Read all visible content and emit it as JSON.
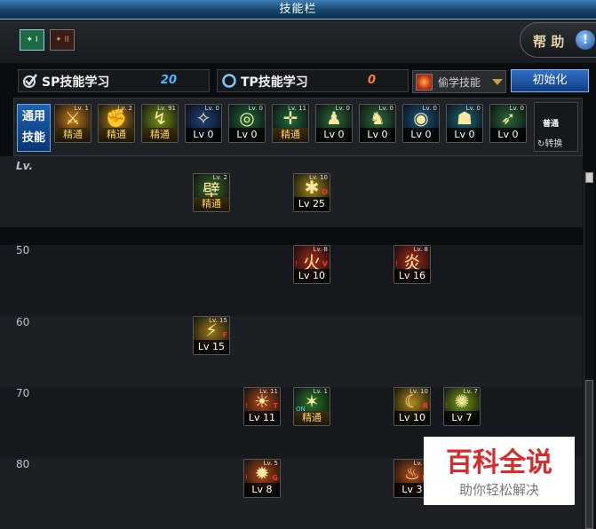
{
  "window": {
    "title": "技能栏"
  },
  "pages": {
    "tab1": "✦ I",
    "tab2": "✦ II"
  },
  "help": {
    "label": "帮 助",
    "icon": "!"
  },
  "sp": {
    "label": "SP技能学习",
    "value": "20"
  },
  "tp": {
    "label": "TP技能学习",
    "value": "0"
  },
  "steal": {
    "label": "偷学技能"
  },
  "init_button": "初始化",
  "common": {
    "label": "通用技能"
  },
  "skill_bar": [
    {
      "icon": "blade-icon",
      "level": "Lv. 1",
      "caption": "精通",
      "master": true,
      "glyph": "⚔",
      "color": "#c77b18"
    },
    {
      "icon": "fist-icon",
      "level": "Lv. 2",
      "caption": "精通",
      "master": true,
      "glyph": "✊",
      "color": "#b5841c"
    },
    {
      "icon": "kick-icon",
      "level": "Lv. 91",
      "caption": "精通",
      "master": true,
      "glyph": "↯",
      "color": "#7a9418"
    },
    {
      "icon": "wing-icon",
      "level": "Lv. 0",
      "caption": "Lv 0",
      "master": false,
      "glyph": "✧",
      "color": "#1f3f7a"
    },
    {
      "icon": "target-icon",
      "level": "Lv. 0",
      "caption": "Lv 0",
      "master": false,
      "glyph": "◎",
      "color": "#1f6a3a"
    },
    {
      "icon": "crosshair-icon",
      "level": "Lv. 11",
      "caption": "精通",
      "master": true,
      "glyph": "✛",
      "color": "#1f6a3a"
    },
    {
      "icon": "figure-icon",
      "level": "Lv. 0",
      "caption": "Lv 0",
      "master": false,
      "glyph": "♟",
      "color": "#2a6c3a"
    },
    {
      "icon": "figure-icon",
      "level": "Lv. 0",
      "caption": "Lv 0",
      "master": false,
      "glyph": "♞",
      "color": "#2a6c3a"
    },
    {
      "icon": "eye-icon",
      "level": "Lv. 0",
      "caption": "Lv 0",
      "master": false,
      "glyph": "◉",
      "color": "#1a5a84"
    },
    {
      "icon": "body-icon",
      "level": "Lv. 0",
      "caption": "Lv 0",
      "master": false,
      "glyph": "☗",
      "color": "#1a6a7a"
    },
    {
      "icon": "leap-icon",
      "level": "Lv. 0",
      "caption": "Lv 0",
      "master": false,
      "glyph": "➶",
      "color": "#2a6a3a"
    }
  ],
  "normal": {
    "badge": "普通",
    "switch_label": "↻转换"
  },
  "tree": {
    "top_label": "Lv.",
    "levels": [
      "50",
      "60",
      "70",
      "80"
    ],
    "skills": [
      {
        "icon": "wall-icon",
        "level": "Lv. 2",
        "caption": "精通",
        "master": true,
        "glyph": "壁",
        "color": "#3a6a2a",
        "tag": "",
        "lock": false,
        "on": false
      },
      {
        "icon": "slash-icon",
        "level": "Lv. 10",
        "caption": "Lv 25",
        "master": false,
        "glyph": "✱",
        "color": "#a08a18",
        "tag": "D",
        "lock": false,
        "on": false
      },
      {
        "icon": "fire-burst-icon",
        "level": "Lv. 8",
        "caption": "Lv 10",
        "master": false,
        "glyph": "火",
        "color": "#a82a18",
        "tag": "V",
        "lock": true,
        "on": false
      },
      {
        "icon": "fire-burst-icon",
        "level": "Lv. 8",
        "caption": "Lv 16",
        "master": false,
        "glyph": "炎",
        "color": "#a82a18",
        "tag": "",
        "lock": true,
        "on": false
      },
      {
        "icon": "claw-icon",
        "level": "Lv. 15",
        "caption": "Lv 15",
        "master": false,
        "glyph": "⚡",
        "color": "#9c7a14",
        "tag": "F",
        "lock": false,
        "on": false
      },
      {
        "icon": "sun-icon",
        "level": "Lv. 11",
        "caption": "Lv 11",
        "master": false,
        "glyph": "☀",
        "color": "#b04a14",
        "tag": "T",
        "lock": true,
        "on": false
      },
      {
        "icon": "aura-icon",
        "level": "Lv. 1",
        "caption": "精通",
        "master": true,
        "glyph": "✶",
        "color": "#2a7a2a",
        "tag": "",
        "lock": false,
        "on": true
      },
      {
        "icon": "crescent-icon",
        "level": "Lv. 10",
        "caption": "Lv 10",
        "master": false,
        "glyph": "☾",
        "color": "#b08a18",
        "tag": "R",
        "lock": false,
        "on": false
      },
      {
        "icon": "burst-icon",
        "level": "Lv. 7",
        "caption": "Lv 7",
        "master": false,
        "glyph": "✺",
        "color": "#7aa018",
        "tag": "",
        "lock": true,
        "on": false
      },
      {
        "icon": "vortex-icon",
        "level": "Lv. 5",
        "caption": "Lv 8",
        "master": false,
        "glyph": "✹",
        "color": "#b04a14",
        "tag": "G",
        "lock": true,
        "on": false
      },
      {
        "icon": "flame-icon",
        "level": "Lv. 3",
        "caption": "Lv 3",
        "master": false,
        "glyph": "♨",
        "color": "#b04a14",
        "tag": "H",
        "lock": false,
        "on": false
      }
    ]
  },
  "watermark": {
    "title": "百科全说",
    "subtitle": "助你轻松解决"
  }
}
